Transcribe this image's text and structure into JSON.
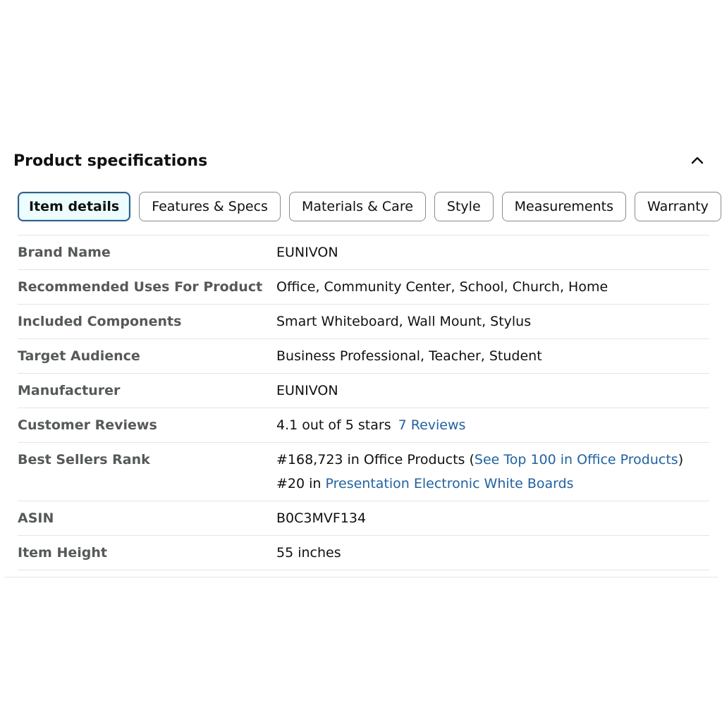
{
  "section": {
    "title": "Product specifications",
    "collapse_icon": "chevron-up-icon"
  },
  "tabs": [
    {
      "label": "Item details",
      "active": true
    },
    {
      "label": "Features & Specs",
      "active": false
    },
    {
      "label": "Materials & Care",
      "active": false
    },
    {
      "label": "Style",
      "active": false
    },
    {
      "label": "Measurements",
      "active": false
    },
    {
      "label": "Warranty",
      "active": false
    }
  ],
  "details": {
    "brand_name": {
      "label": "Brand Name",
      "value": "EUNIVON"
    },
    "recommended_uses": {
      "label": "Recommended Uses For Product",
      "value": "Office, Community Center, School, Church, Home"
    },
    "included_components": {
      "label": "Included Components",
      "value": "Smart Whiteboard, Wall Mount, Stylus"
    },
    "target_audience": {
      "label": "Target Audience",
      "value": "Business Professional, Teacher, Student"
    },
    "manufacturer": {
      "label": "Manufacturer",
      "value": "EUNIVON"
    },
    "customer_reviews": {
      "label": "Customer Reviews",
      "rating_text": "4.1 out of 5 stars",
      "reviews_link": "7 Reviews"
    },
    "best_sellers_rank": {
      "label": "Best Sellers Rank",
      "rank1_prefix": "#168,723 in Office Products (",
      "rank1_link": "See Top 100 in Office Products",
      "rank1_suffix": ")",
      "rank2_prefix": "#20 in ",
      "rank2_link": "Presentation Electronic White Boards"
    },
    "asin": {
      "label": "ASIN",
      "value": "B0C3MVF134"
    },
    "item_height": {
      "label": "Item Height",
      "value": "55 inches"
    }
  },
  "colors": {
    "link": "#2162a1",
    "active_tab_border": "#2e5f8a",
    "active_tab_bg": "#edfdff",
    "label_text": "#565959",
    "divider": "#e3e6e6"
  }
}
